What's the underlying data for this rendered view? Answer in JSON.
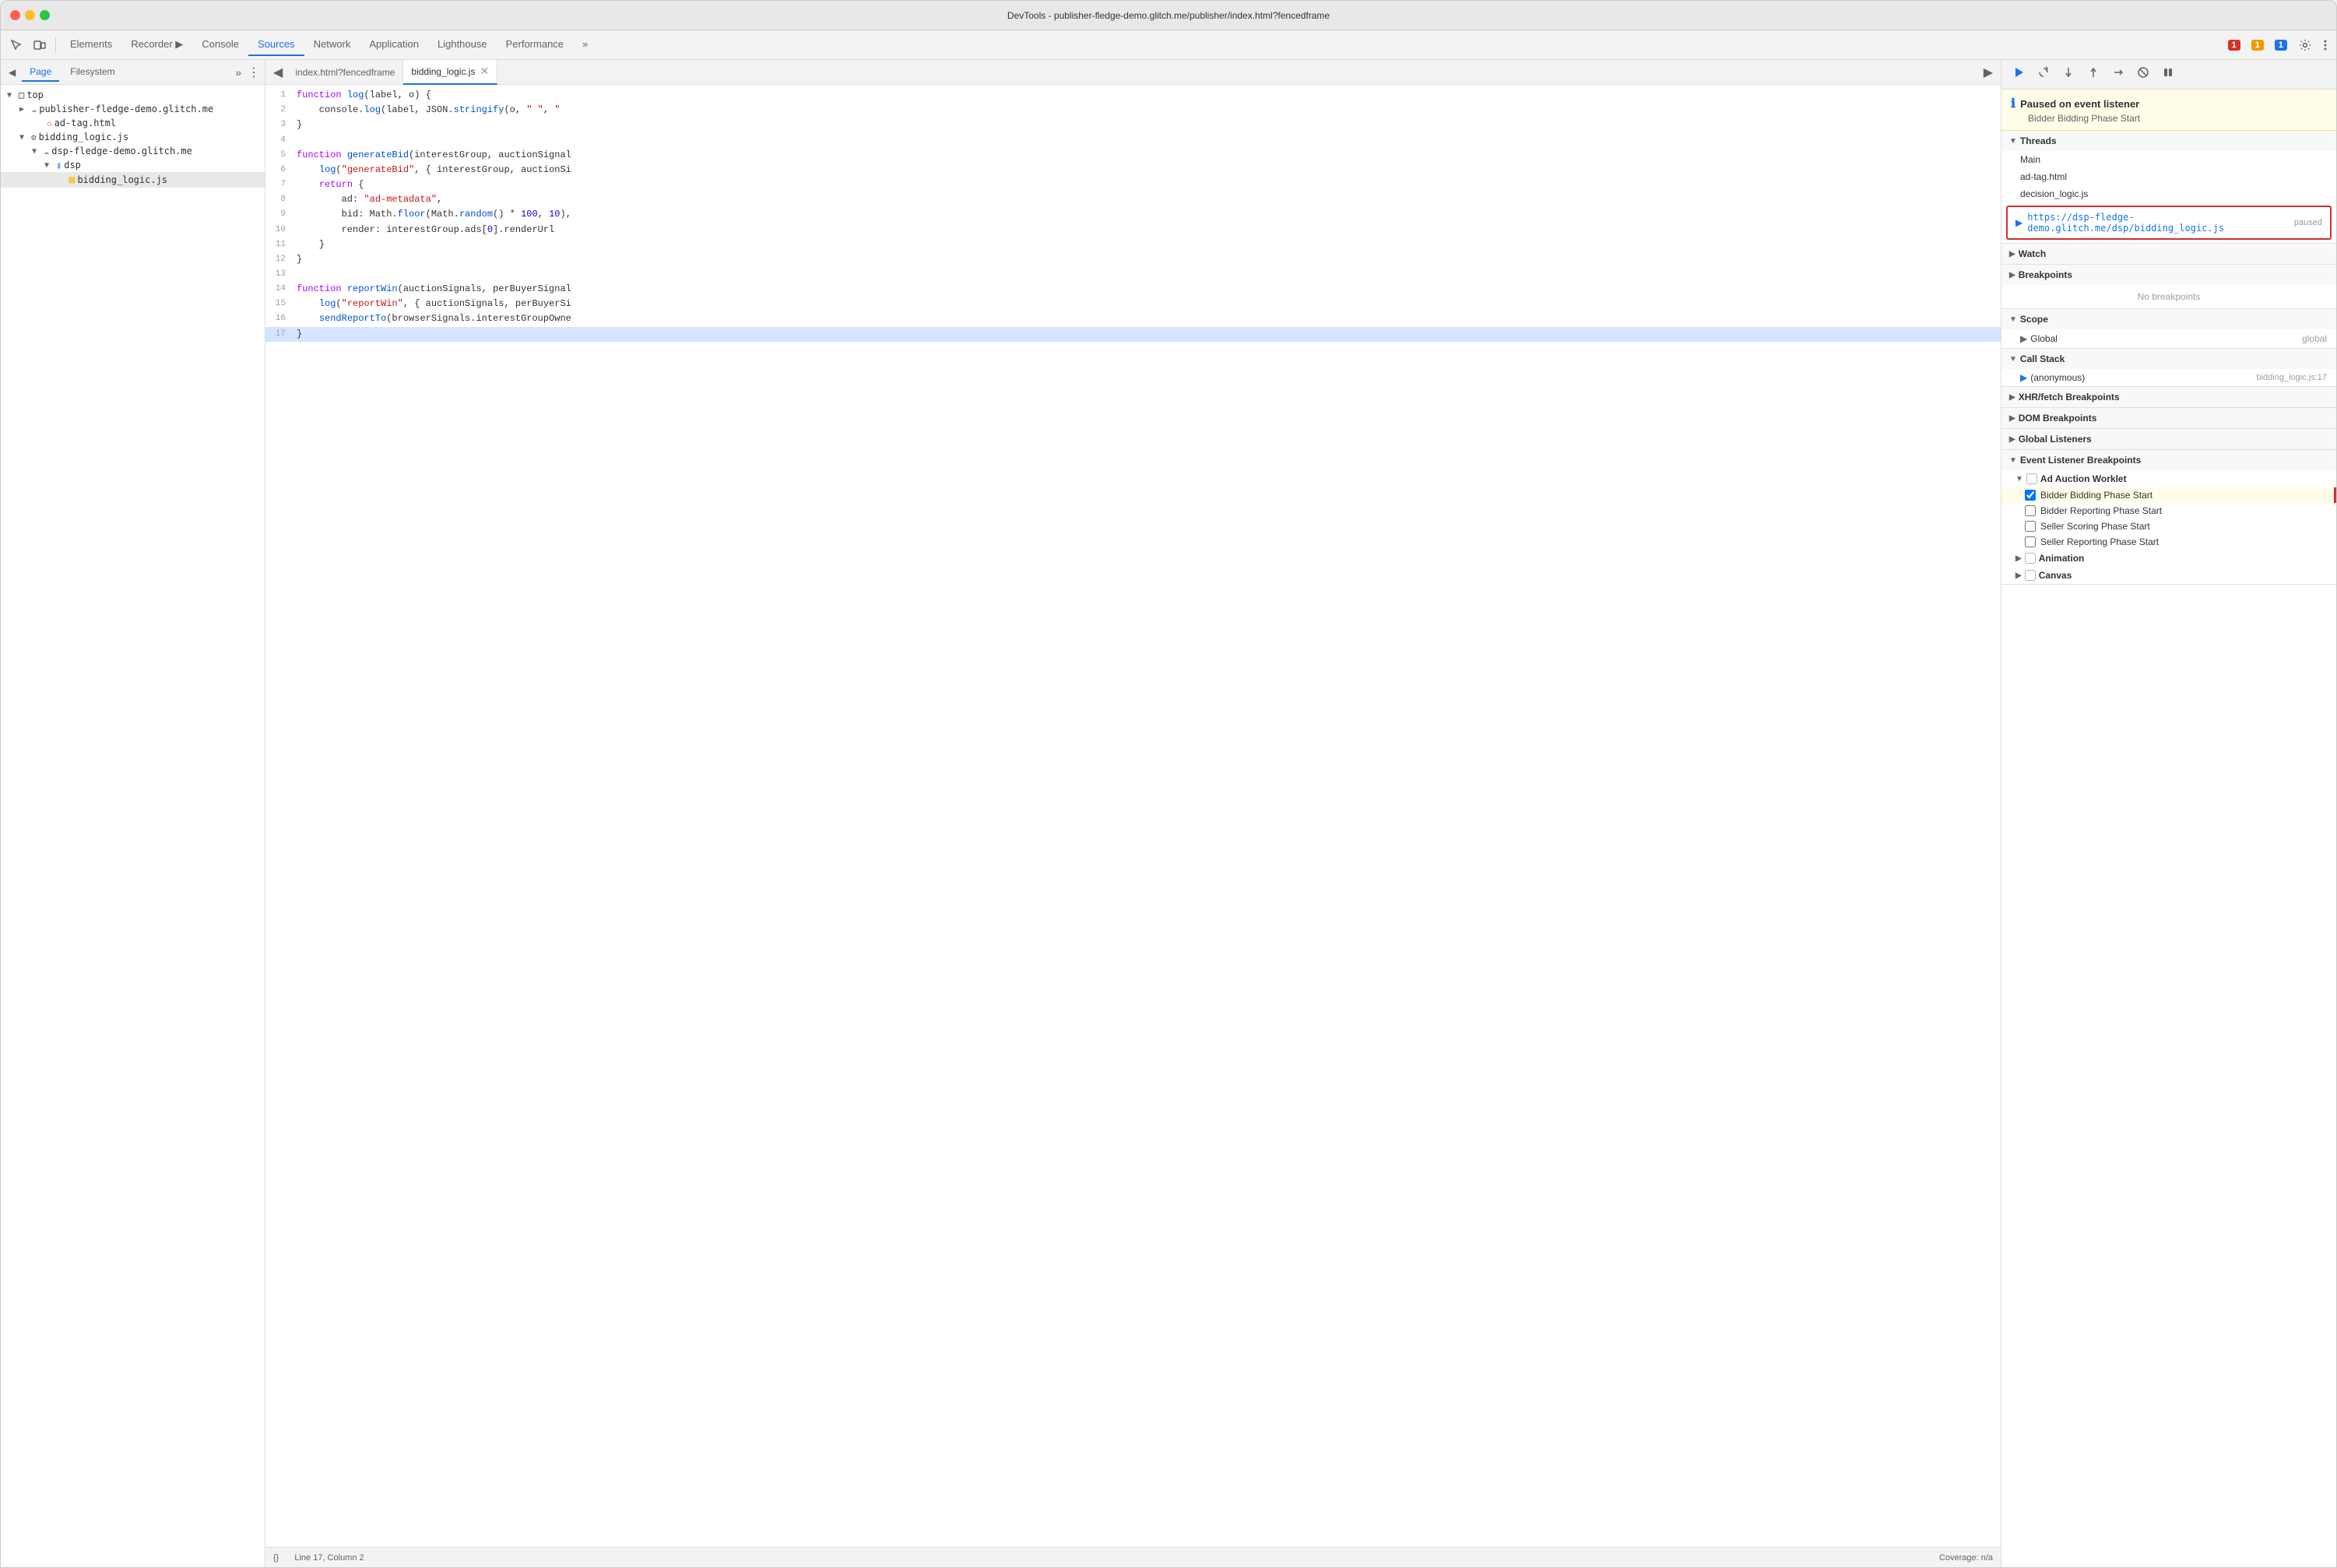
{
  "window": {
    "title": "DevTools - publisher-fledge-demo.glitch.me/publisher/index.html?fencedframe"
  },
  "toolbar": {
    "tabs": [
      {
        "label": "Elements",
        "active": false
      },
      {
        "label": "Recorder ▶",
        "active": false
      },
      {
        "label": "Console",
        "active": false
      },
      {
        "label": "Sources",
        "active": true
      },
      {
        "label": "Network",
        "active": false
      },
      {
        "label": "Application",
        "active": false
      },
      {
        "label": "Lighthouse",
        "active": false
      },
      {
        "label": "Performance",
        "active": false
      }
    ],
    "more_tabs": "»",
    "error_count": "1",
    "warning_count": "1",
    "info_count": "1"
  },
  "left_panel": {
    "tabs": [
      {
        "label": "Page",
        "active": true
      },
      {
        "label": "Filesystem",
        "active": false
      }
    ],
    "more": "»",
    "tree": [
      {
        "indent": 0,
        "type": "arrow-folder",
        "icon": "folder",
        "label": "top",
        "expanded": true
      },
      {
        "indent": 1,
        "type": "arrow-folder",
        "icon": "cloud",
        "label": "publisher-fledge-demo.glitch.me",
        "expanded": false
      },
      {
        "indent": 2,
        "type": "file",
        "icon": "html",
        "label": "ad-tag.html"
      },
      {
        "indent": 1,
        "type": "arrow-folder",
        "icon": "gear-folder",
        "label": "bidding_logic.js",
        "expanded": true,
        "selected": false
      },
      {
        "indent": 2,
        "type": "arrow-folder",
        "icon": "cloud",
        "label": "dsp-fledge-demo.glitch.me",
        "expanded": true
      },
      {
        "indent": 3,
        "type": "folder",
        "icon": "folder-blue",
        "label": "dsp",
        "expanded": true
      },
      {
        "indent": 4,
        "type": "file",
        "icon": "js",
        "label": "bidding_logic.js",
        "active": true
      }
    ]
  },
  "editor": {
    "tabs": [
      {
        "label": "index.html?fencedframe",
        "active": false,
        "closeable": false
      },
      {
        "label": "bidding_logic.js",
        "active": true,
        "closeable": true
      }
    ],
    "code_lines": [
      {
        "num": 1,
        "content": "function log(label, o) {"
      },
      {
        "num": 2,
        "content": "    console.log(label, JSON.stringify(o, \" \", \""
      },
      {
        "num": 3,
        "content": "}"
      },
      {
        "num": 4,
        "content": ""
      },
      {
        "num": 5,
        "content": "function generateBid(interestGroup, auctionSignal"
      },
      {
        "num": 6,
        "content": "    log(\"generateBid\", { interestGroup, auctionSi"
      },
      {
        "num": 7,
        "content": "    return {"
      },
      {
        "num": 8,
        "content": "        ad: \"ad-metadata\","
      },
      {
        "num": 9,
        "content": "        bid: Math.floor(Math.random() * 100, 10),"
      },
      {
        "num": 10,
        "content": "        render: interestGroup.ads[0].renderUrl"
      },
      {
        "num": 11,
        "content": "    }"
      },
      {
        "num": 12,
        "content": "}"
      },
      {
        "num": 13,
        "content": ""
      },
      {
        "num": 14,
        "content": "function reportWin(auctionSignals, perBuyerSignal"
      },
      {
        "num": 15,
        "content": "    log(\"reportWin\", { auctionSignals, perBuyerSi"
      },
      {
        "num": 16,
        "content": "    sendReportTo(browserSignals.interestGroupOwne"
      },
      {
        "num": 17,
        "content": "}"
      }
    ],
    "highlighted_line": 17,
    "statusbar": {
      "left": "{}",
      "line_col": "Line 17, Column 2",
      "coverage": "Coverage: n/a"
    }
  },
  "right_panel": {
    "paused_banner": {
      "title": "Paused on event listener",
      "subtitle": "Bidder Bidding Phase Start"
    },
    "sections": {
      "threads": {
        "label": "Threads",
        "items": [
          {
            "label": "Main",
            "active": false
          },
          {
            "label": "ad-tag.html",
            "active": false
          },
          {
            "label": "decision_logic.js",
            "active": false
          },
          {
            "url": "https://dsp-fledge-demo.glitch.me/dsp/bidding_logic.js",
            "status": "paused",
            "highlighted": true
          }
        ]
      },
      "watch": {
        "label": "Watch"
      },
      "breakpoints": {
        "label": "Breakpoints",
        "empty_msg": "No breakpoints"
      },
      "scope": {
        "label": "Scope",
        "items": [
          {
            "label": "Global",
            "value": "global"
          }
        ]
      },
      "call_stack": {
        "label": "Call Stack",
        "items": [
          {
            "label": "(anonymous)",
            "location": "bidding_logic.js:17"
          }
        ]
      },
      "xhr_breakpoints": {
        "label": "XHR/fetch Breakpoints"
      },
      "dom_breakpoints": {
        "label": "DOM Breakpoints"
      },
      "global_listeners": {
        "label": "Global Listeners"
      },
      "event_listener_breakpoints": {
        "label": "Event Listener Breakpoints",
        "groups": [
          {
            "label": "Ad Auction Worklet",
            "expanded": true,
            "items": [
              {
                "label": "Bidder Bidding Phase Start",
                "checked": true,
                "highlighted": true
              },
              {
                "label": "Bidder Reporting Phase Start",
                "checked": false
              },
              {
                "label": "Seller Scoring Phase Start",
                "checked": false
              },
              {
                "label": "Seller Reporting Phase Start",
                "checked": false
              }
            ]
          },
          {
            "label": "Animation",
            "expanded": false,
            "items": []
          },
          {
            "label": "Canvas",
            "expanded": false,
            "items": []
          }
        ]
      }
    }
  }
}
